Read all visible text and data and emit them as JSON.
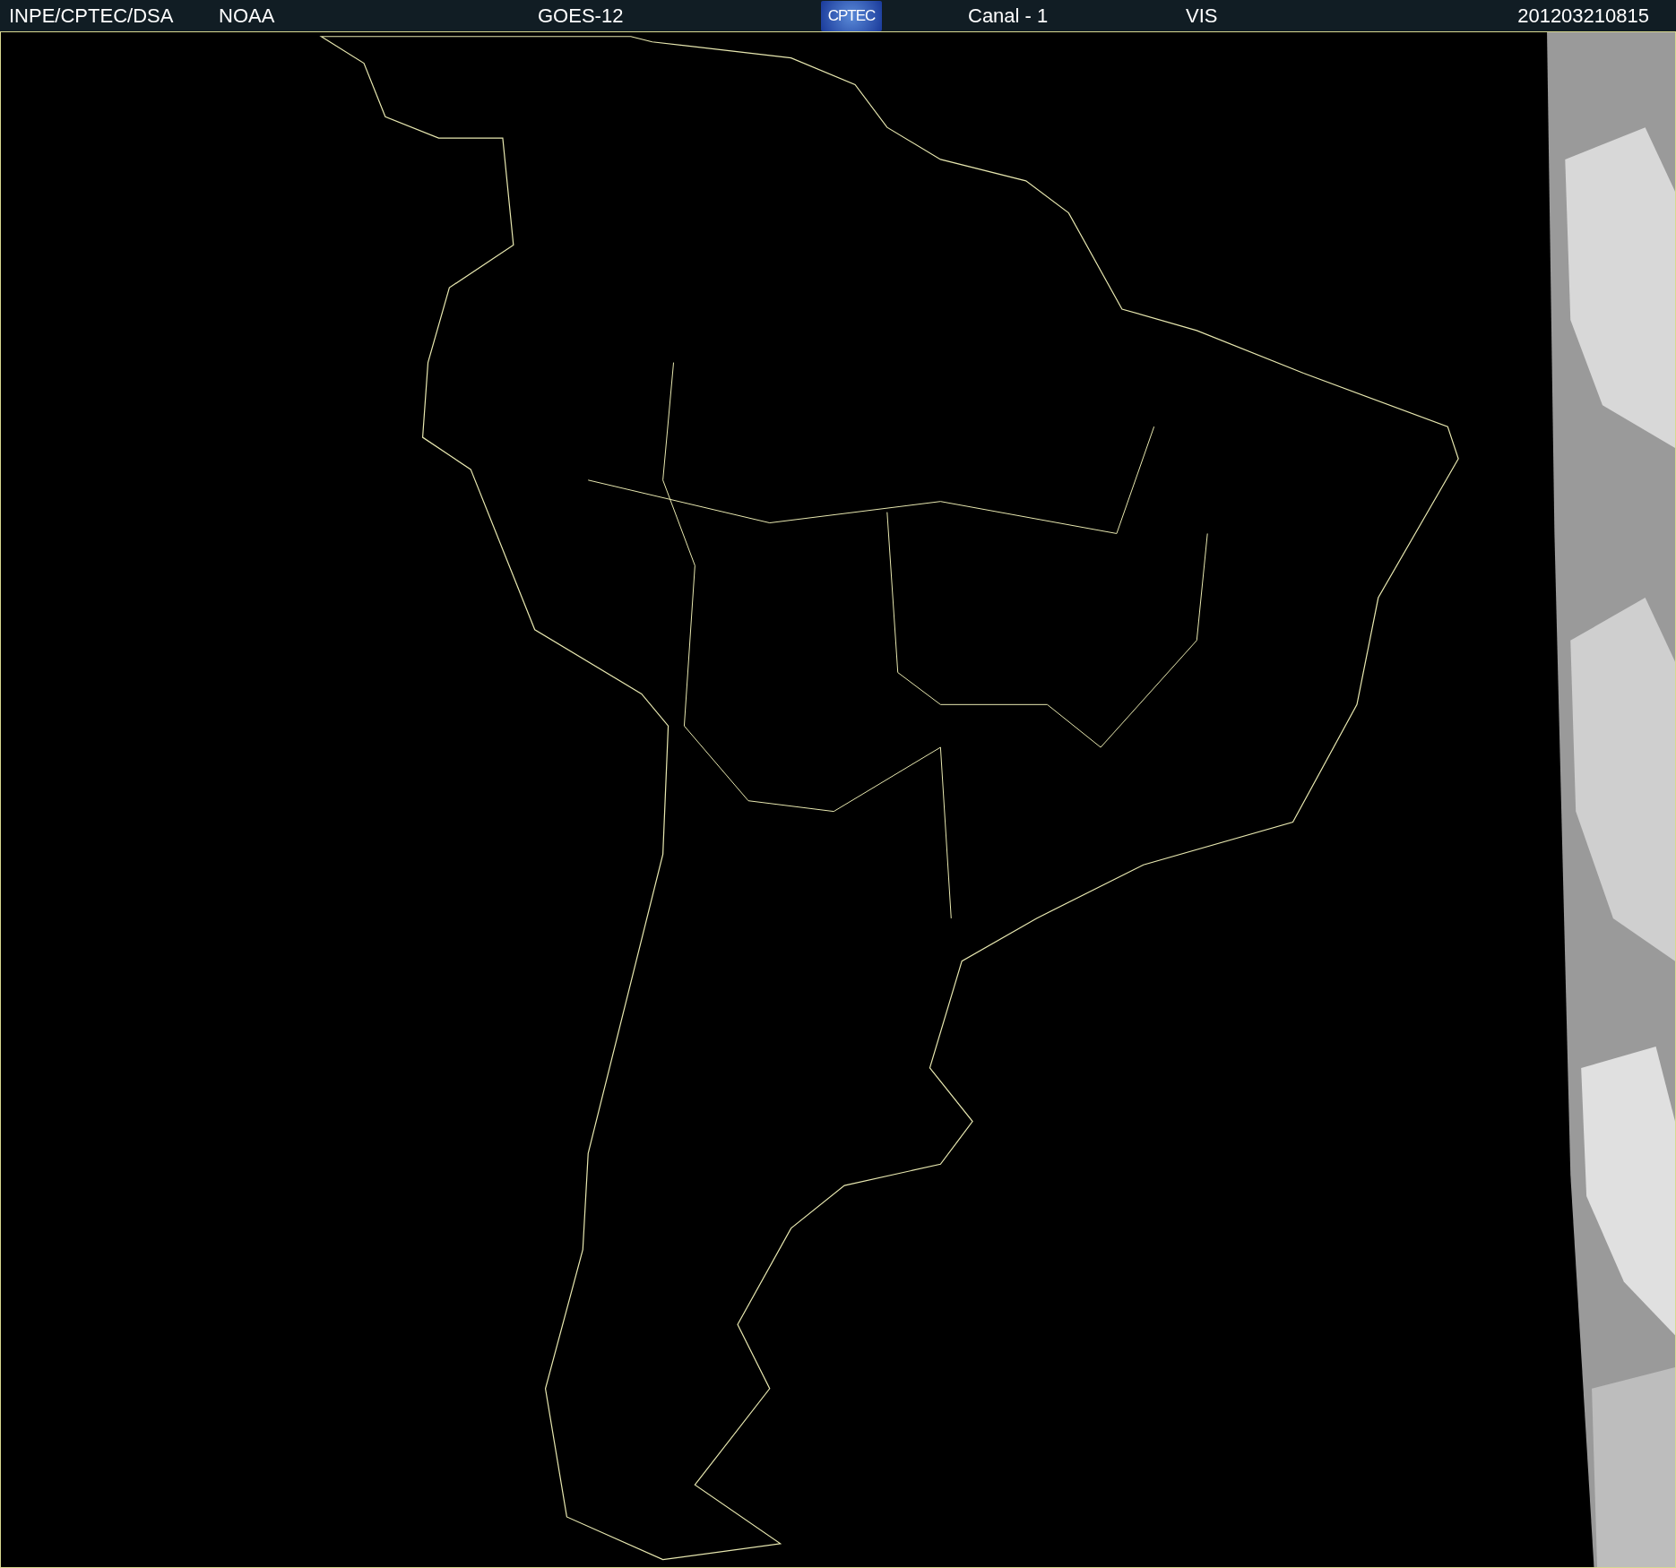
{
  "header": {
    "source": "INPE/CPTEC/DSA",
    "agency": "NOAA",
    "satellite": "GOES-12",
    "logo": "CPTEC",
    "channel": "Canal - 1",
    "band": "VIS",
    "timestamp": "201203210815"
  }
}
